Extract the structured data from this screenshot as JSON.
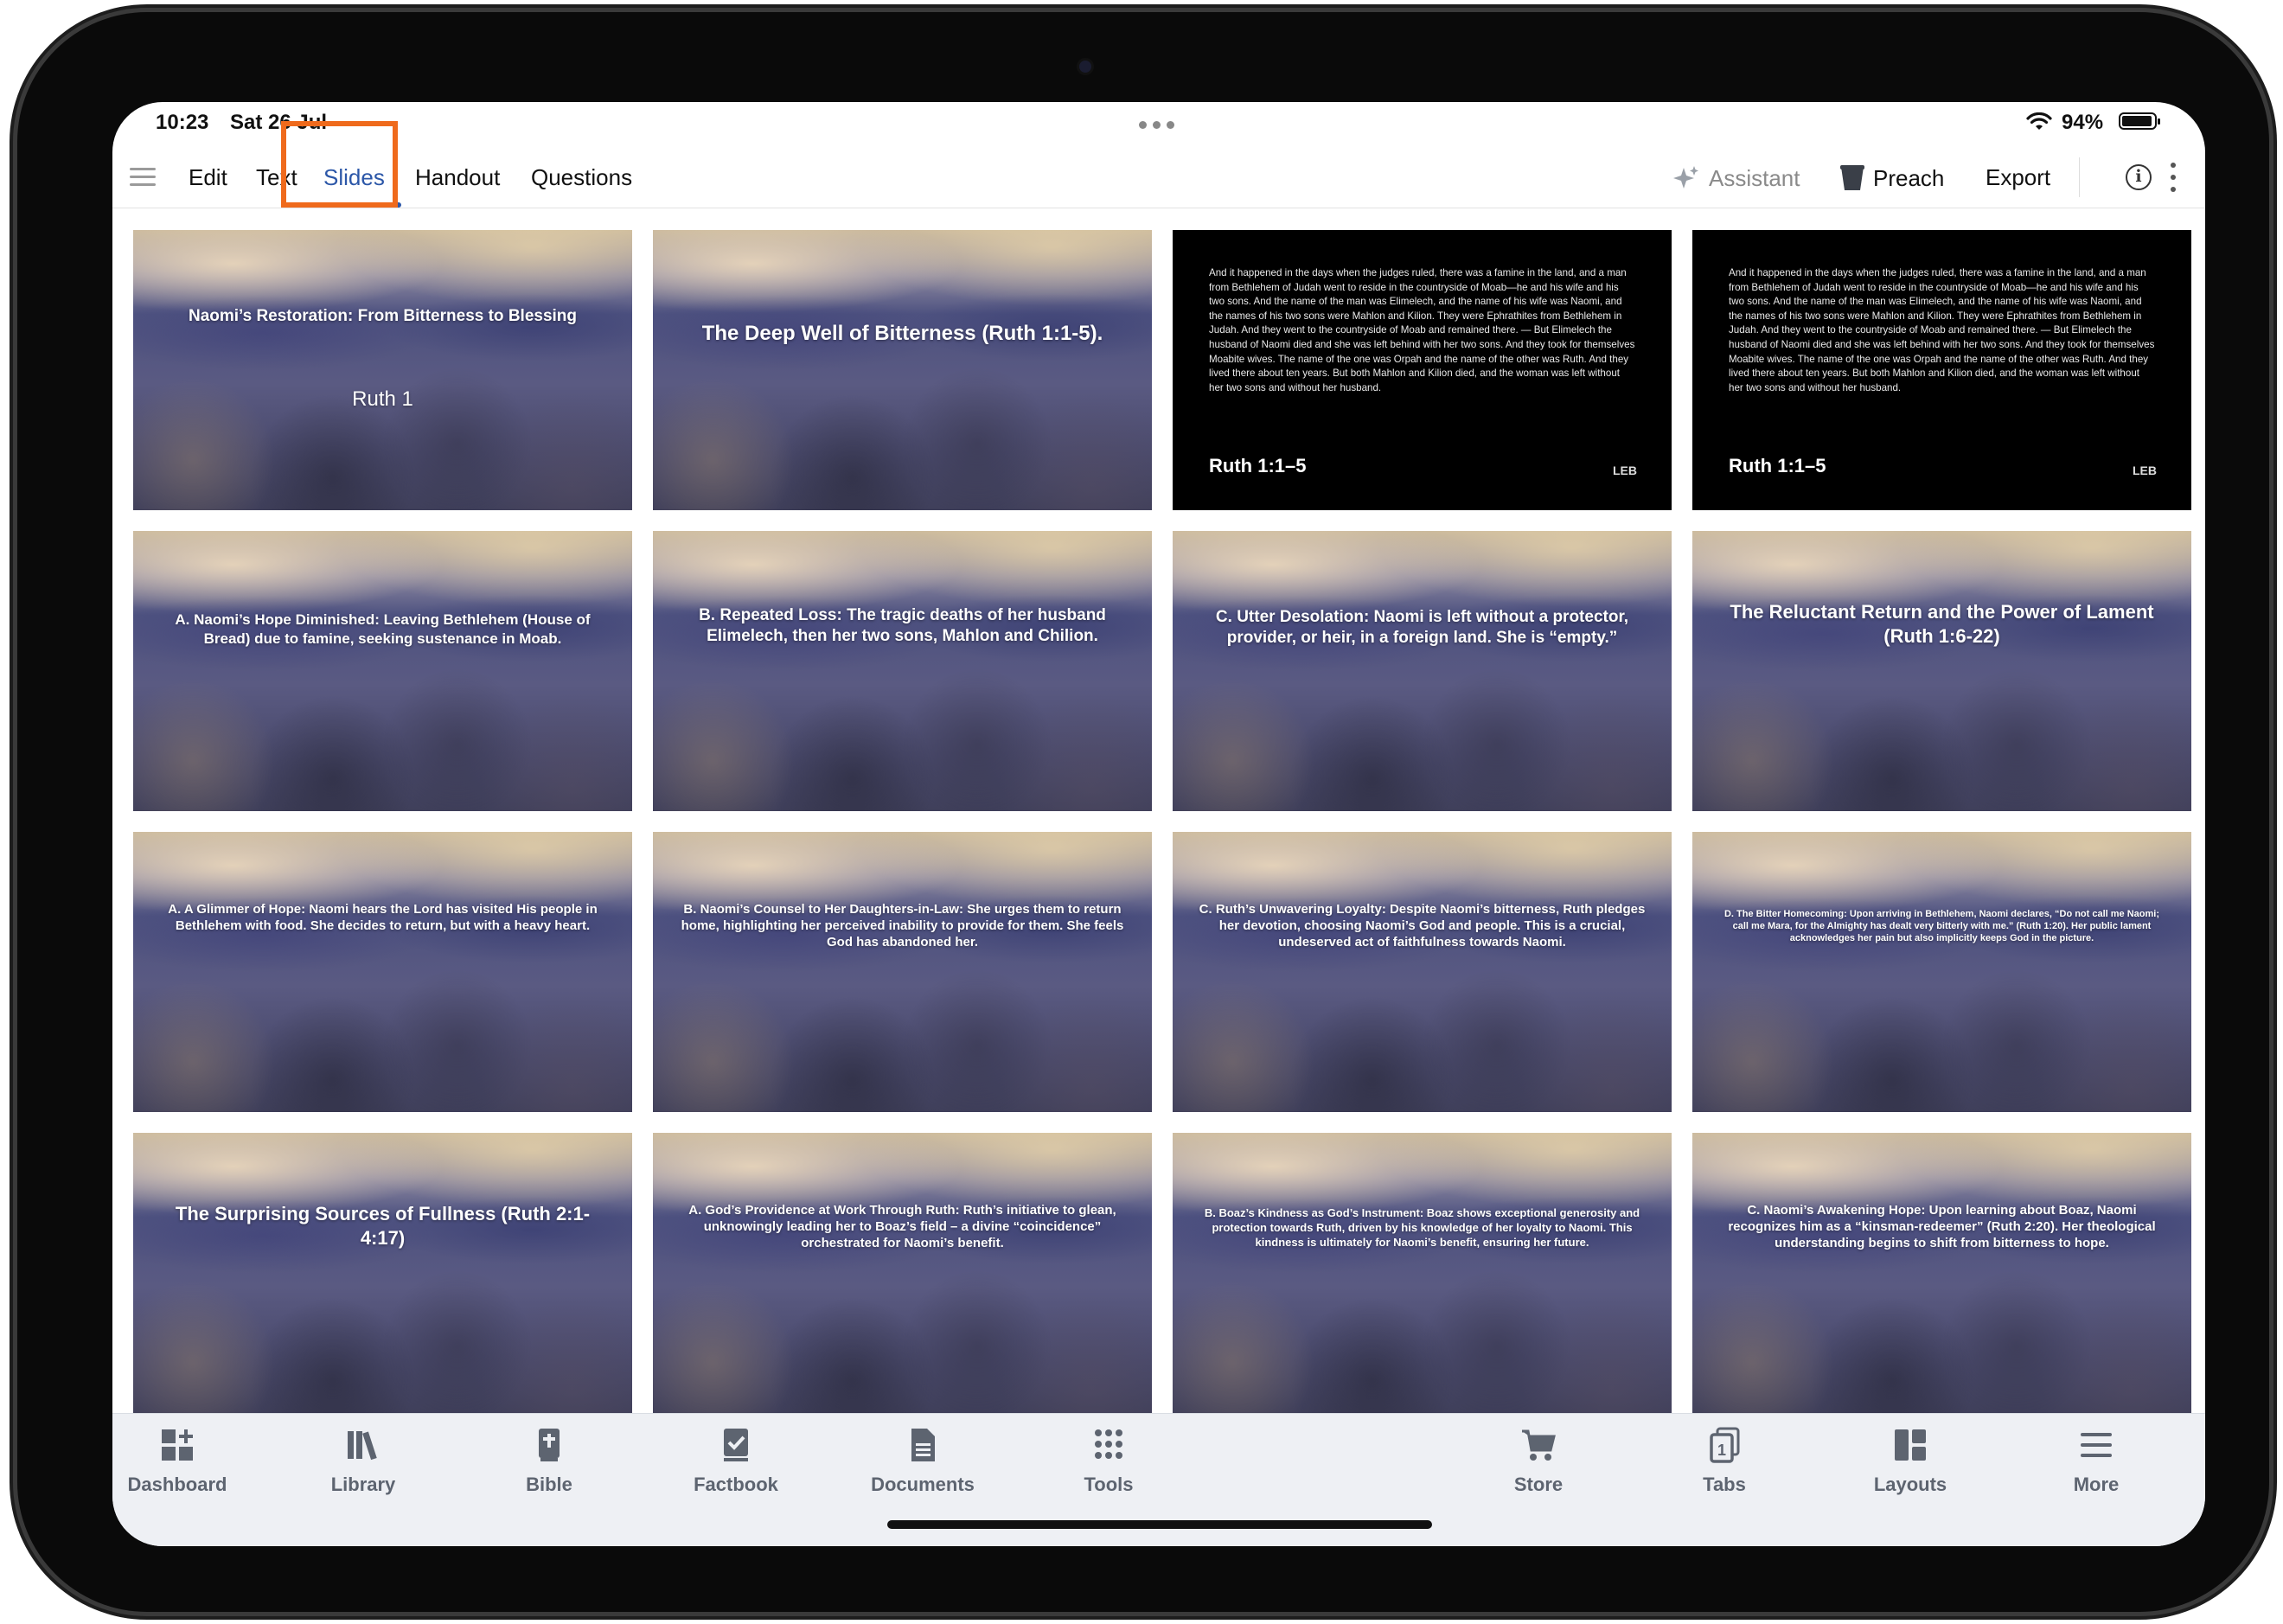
{
  "status_bar": {
    "time": "10:23",
    "date": "Sat 26 Jul",
    "battery": "94%"
  },
  "toolbar": {
    "tabs": [
      {
        "label": "Edit"
      },
      {
        "label": "Text"
      },
      {
        "label": "Slides",
        "active": true
      },
      {
        "label": "Handout"
      },
      {
        "label": "Questions"
      }
    ],
    "assistant_label": "Assistant",
    "preach_label": "Preach",
    "export_label": "Export",
    "info_glyph": "i"
  },
  "slides": [
    {
      "kind": "photo",
      "title": "Naomi’s Restoration: From Bitterness to Blessing",
      "subtitle": "Ruth 1"
    },
    {
      "kind": "photo",
      "title": "The Deep Well of Bitterness (Ruth 1:1-5)."
    },
    {
      "kind": "verse",
      "text": "And it happened in the days when the judges ruled, there was a famine in the land, and a man from Bethlehem of Judah went to reside in the countryside of Moab—he and his wife and his two sons. And the name of the man was Elimelech, and the name of his wife was Naomi, and the names of his two sons were Mahlon and Kilion. They were Ephrathites from Bethlehem in Judah. And they went to the countryside of Moab and remained there. — But Elimelech the husband of Naomi died and she was left behind with her two sons. And they took for themselves Moabite wives. The name of the one was Orpah and the name of the other was Ruth. And they lived there about ten years. But both Mahlon and Kilion died, and the woman was left without her two sons and without her husband.",
      "reference": "Ruth 1:1–5",
      "version": "LEB"
    },
    {
      "kind": "verse",
      "text": "And it happened in the days when the judges ruled, there was a famine in the land, and a man from Bethlehem of Judah went to reside in the countryside of Moab—he and his wife and his two sons. And the name of the man was Elimelech, and the name of his wife was Naomi, and the names of his two sons were Mahlon and Kilion. They were Ephrathites from Bethlehem in Judah. And they went to the countryside of Moab and remained there. — But Elimelech the husband of Naomi died and she was left behind with her two sons. And they took for themselves Moabite wives. The name of the one was Orpah and the name of the other was Ruth. And they lived there about ten years. But both Mahlon and Kilion died, and the woman was left without her two sons and without her husband.",
      "reference": "Ruth 1:1–5",
      "version": "LEB"
    },
    {
      "kind": "photo",
      "title": "A. Naomi’s Hope Diminished: Leaving Bethlehem (House of Bread) due to famine, seeking sustenance in Moab."
    },
    {
      "kind": "photo",
      "title": "B. Repeated Loss: The tragic deaths of her husband Elimelech, then her two sons, Mahlon and Chilion."
    },
    {
      "kind": "photo",
      "title": "C. Utter Desolation: Naomi is left without a protector, provider, or heir, in a foreign land. She is “empty.”"
    },
    {
      "kind": "photo",
      "title": "The Reluctant Return and the Power of Lament (Ruth 1:6-22)"
    },
    {
      "kind": "photo",
      "title": "A. A Glimmer of Hope: Naomi hears the Lord has visited His people in Bethlehem with food. She decides to return, but with a heavy heart."
    },
    {
      "kind": "photo",
      "title": "B. Naomi’s Counsel to Her Daughters-in-Law: She urges them to return home, highlighting her perceived inability to provide for them. She feels God has abandoned her."
    },
    {
      "kind": "photo",
      "title": "C. Ruth’s Unwavering Loyalty: Despite Naomi’s bitterness, Ruth pledges her devotion, choosing Naomi’s God and people. This is a crucial, undeserved act of faithfulness towards Naomi."
    },
    {
      "kind": "photo",
      "title": "D. The Bitter Homecoming: Upon arriving in Bethlehem, Naomi declares, “Do not call me Naomi; call me Mara, for the Almighty has dealt very bitterly with me.” (Ruth 1:20). Her public lament acknowledges her pain but also implicitly keeps God in the picture."
    },
    {
      "kind": "photo",
      "title": "The Surprising Sources of Fullness (Ruth 2:1-4:17)"
    },
    {
      "kind": "photo",
      "title": "A. God’s Providence at Work Through Ruth: Ruth’s initiative to glean, unknowingly leading her to Boaz’s field – a divine “coincidence” orchestrated for Naomi’s benefit."
    },
    {
      "kind": "photo",
      "title": "B. Boaz’s Kindness as God’s Instrument: Boaz shows exceptional generosity and protection towards Ruth, driven by his knowledge of her loyalty to Naomi. This kindness is ultimately for Naomi’s benefit, ensuring her future."
    },
    {
      "kind": "photo",
      "title": "C. Naomi’s Awakening Hope: Upon learning about Boaz, Naomi recognizes him as a “kinsman-redeemer” (Ruth 2:20). Her theological understanding begins to shift from bitterness to hope."
    }
  ],
  "bottom_nav": [
    {
      "label": "Dashboard",
      "icon": "dashboard-icon"
    },
    {
      "label": "Library",
      "icon": "library-icon"
    },
    {
      "label": "Bible",
      "icon": "bible-icon"
    },
    {
      "label": "Factbook",
      "icon": "factbook-icon"
    },
    {
      "label": "Documents",
      "icon": "documents-icon"
    },
    {
      "label": "Tools",
      "icon": "tools-icon"
    },
    {
      "label": "Store",
      "icon": "cart-icon"
    },
    {
      "label": "Tabs",
      "icon": "tabs-icon",
      "badge": "1"
    },
    {
      "label": "Layouts",
      "icon": "layouts-icon"
    },
    {
      "label": "More",
      "icon": "menu-icon"
    }
  ],
  "colors": {
    "accent": "#2c57a8",
    "highlight": "#ef6a1c",
    "nav_text": "#5d6470"
  }
}
